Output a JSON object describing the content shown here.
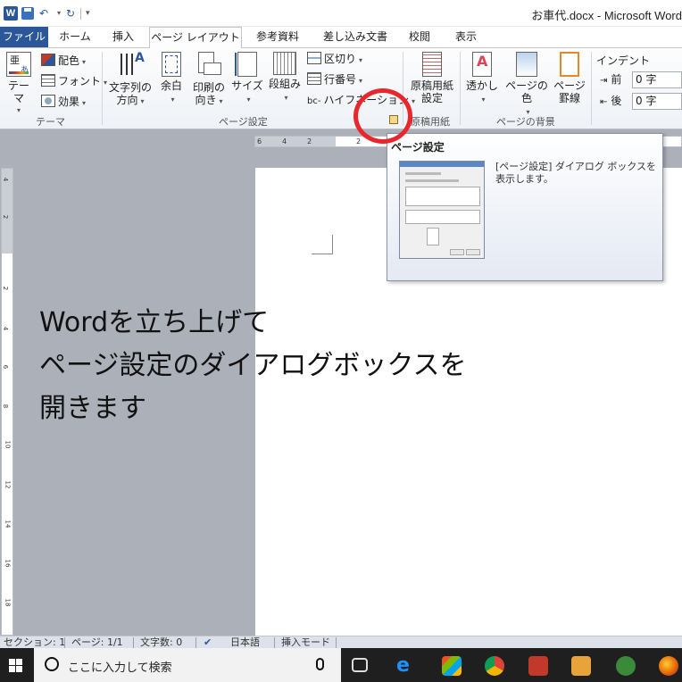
{
  "window": {
    "title": "お車代.docx - Microsoft Word",
    "app_logo": "W"
  },
  "quick_access": {
    "save_icon": "save-icon",
    "undo_icon": "undo-icon",
    "redo_icon": "redo-icon"
  },
  "tabs": [
    {
      "label": "ファイル"
    },
    {
      "label": "ホーム"
    },
    {
      "label": "挿入"
    },
    {
      "label": "ページ レイアウト"
    },
    {
      "label": "参考資料"
    },
    {
      "label": "差し込み文書"
    },
    {
      "label": "校閲"
    },
    {
      "label": "表示"
    }
  ],
  "ribbon": {
    "theme": {
      "big_label": "テーマ",
      "colors": "配色",
      "fonts": "フォント",
      "effects": "効果",
      "group_label": "テーマ"
    },
    "page_setup": {
      "text_dir": [
        "文字列の",
        "方向"
      ],
      "margins": "余白",
      "orientation": [
        "印刷の",
        "向き"
      ],
      "size": "サイズ",
      "columns": "段組み",
      "breaks": "区切り",
      "line_numbers": "行番号",
      "hyphenation": "ハイフネーション",
      "hyphen_glyph": "bc-",
      "group_label": "ページ設定"
    },
    "manuscript": {
      "label": [
        "原稿用紙",
        "設定"
      ],
      "group_label": "原稿用紙"
    },
    "background": {
      "watermark": "透かし",
      "page_color": "ページの色",
      "page_borders": [
        "ページ",
        "罫線"
      ],
      "group_label": "ページの背景"
    },
    "indent": {
      "title": "インデント",
      "before_label": "前",
      "before_value": "0 字",
      "after_label": "後",
      "after_value": "0 字"
    }
  },
  "rulers": {
    "h_ticks": [
      "6",
      "4",
      "2",
      "2"
    ],
    "v_ticks": [
      "4",
      "2",
      "2",
      "4",
      "6",
      "8",
      "10",
      "12",
      "14",
      "16",
      "18"
    ]
  },
  "tooltip": {
    "title": "ページ設定",
    "description": "[ページ設定] ダイアログ ボックスを表示します。"
  },
  "caption": {
    "lines": [
      "Wordを立ち上げて",
      "ページ設定のダイアログボックスを",
      "開きます"
    ]
  },
  "statusbar": {
    "section": "セクション: 1",
    "page": "ページ: 1/1",
    "words": "文字数: 0",
    "language": "日本語",
    "mode": "挿入モード"
  },
  "taskbar": {
    "search_placeholder": "ここに入力して検索"
  },
  "colors": {
    "accent": "#2b579a",
    "circle": "#e8262b"
  }
}
